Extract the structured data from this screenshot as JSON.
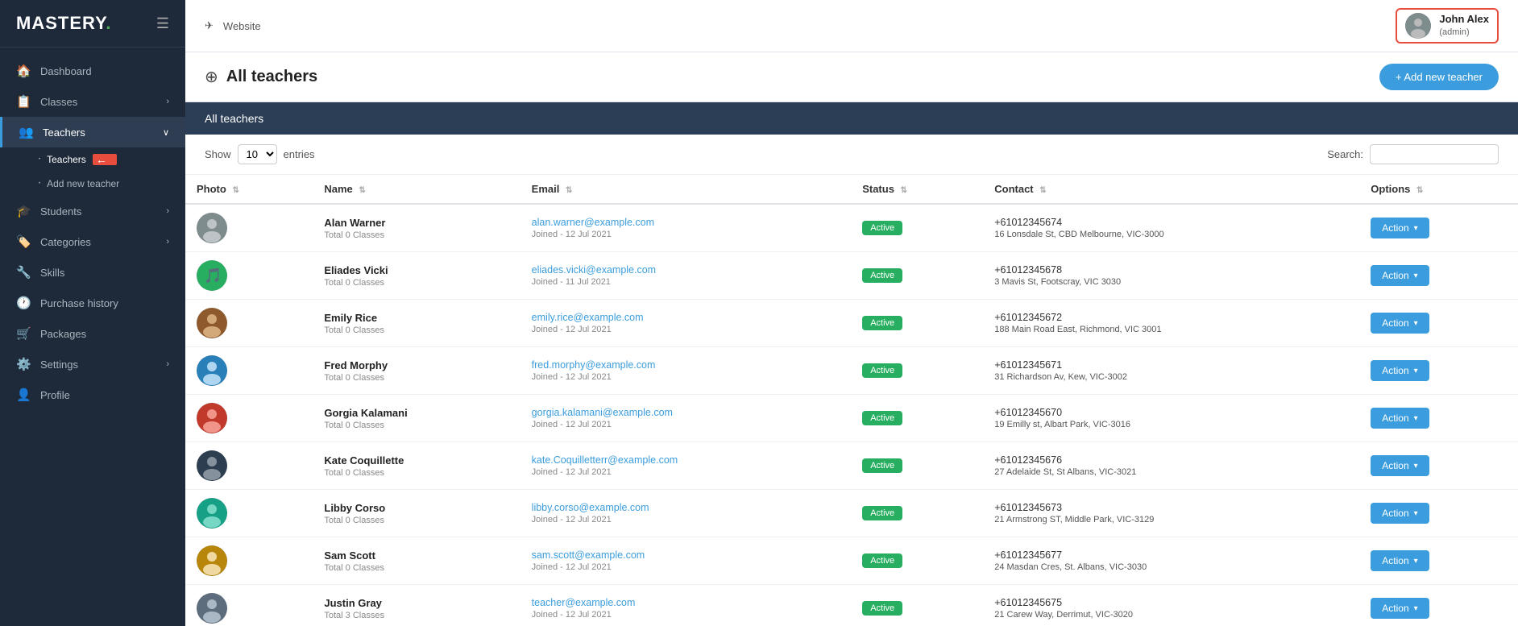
{
  "app": {
    "logo": "MASTERY.",
    "logo_dot": "."
  },
  "sidebar": {
    "items": [
      {
        "id": "dashboard",
        "label": "Dashboard",
        "icon": "🏠",
        "hasChevron": false
      },
      {
        "id": "classes",
        "label": "Classes",
        "icon": "📋",
        "hasChevron": true
      },
      {
        "id": "teachers",
        "label": "Teachers",
        "icon": "👥",
        "hasChevron": true,
        "active": true
      },
      {
        "id": "students",
        "label": "Students",
        "icon": "🎓",
        "hasChevron": true
      },
      {
        "id": "categories",
        "label": "Categories",
        "icon": "🏷️",
        "hasChevron": true
      },
      {
        "id": "skills",
        "label": "Skills",
        "icon": "🔧",
        "hasChevron": false
      },
      {
        "id": "purchase_history",
        "label": "Purchase history",
        "icon": "🕐",
        "hasChevron": false
      },
      {
        "id": "packages",
        "label": "Packages",
        "icon": "🛒",
        "hasChevron": false
      },
      {
        "id": "settings",
        "label": "Settings",
        "icon": "⚙️",
        "hasChevron": true
      },
      {
        "id": "profile",
        "label": "Profile",
        "icon": "👤",
        "hasChevron": false
      }
    ],
    "sub_items_teachers": [
      {
        "id": "teachers_sub",
        "label": "Teachers",
        "active": true
      },
      {
        "id": "add_new_teacher",
        "label": "Add new teacher",
        "active": false
      }
    ]
  },
  "topbar": {
    "website_label": "Website"
  },
  "user": {
    "name": "John Alex",
    "role": "(admin)"
  },
  "page": {
    "title": "All teachers",
    "add_button_label": "+ Add new teacher"
  },
  "table": {
    "section_title": "All teachers",
    "show_label": "Show",
    "entries_label": "entries",
    "entries_value": "10",
    "search_label": "Search:",
    "columns": [
      "Photo",
      "Name",
      "Email",
      "Status",
      "Contact",
      "Options"
    ],
    "action_label": "Action ▾",
    "teachers": [
      {
        "id": 1,
        "avatar_color": "avatar-gray",
        "avatar_char": "👤",
        "name": "Alan Warner",
        "classes": "Total 0 Classes",
        "email": "alan.warner@example.com",
        "joined": "Joined - 12 Jul 2021",
        "status": "Active",
        "phone": "+61012345674",
        "address": "16 Lonsdale St, CBD Melbourne, VIC-3000"
      },
      {
        "id": 2,
        "avatar_color": "avatar-green",
        "avatar_char": "🎵",
        "name": "Eliades Vicki",
        "classes": "Total 0 Classes",
        "email": "eliades.vicki@example.com",
        "joined": "Joined - 11 Jul 2021",
        "status": "Active",
        "phone": "+61012345678",
        "address": "3 Mavis St, Footscray, VIC 3030"
      },
      {
        "id": 3,
        "avatar_color": "avatar-brown",
        "avatar_char": "👤",
        "name": "Emily Rice",
        "classes": "Total 0 Classes",
        "email": "emily.rice@example.com",
        "joined": "Joined - 12 Jul 2021",
        "status": "Active",
        "phone": "+61012345672",
        "address": "188 Main Road East, Richmond, VIC 3001"
      },
      {
        "id": 4,
        "avatar_color": "avatar-blue",
        "avatar_char": "👤",
        "name": "Fred Morphy",
        "classes": "Total 0 Classes",
        "email": "fred.morphy@example.com",
        "joined": "Joined - 12 Jul 2021",
        "status": "Active",
        "phone": "+61012345671",
        "address": "31 Richardson Av, Kew, VIC-3002"
      },
      {
        "id": 5,
        "avatar_color": "avatar-red",
        "avatar_char": "👤",
        "name": "Gorgia Kalamani",
        "classes": "Total 0 Classes",
        "email": "gorgia.kalamani@example.com",
        "joined": "Joined - 12 Jul 2021",
        "status": "Active",
        "phone": "+61012345670",
        "address": "19 Emilly st, Albart Park, VIC-3016"
      },
      {
        "id": 6,
        "avatar_color": "avatar-dark",
        "avatar_char": "👤",
        "name": "Kate Coquillette",
        "classes": "Total 0 Classes",
        "email": "kate.Coquilletterr@example.com",
        "joined": "Joined - 12 Jul 2021",
        "status": "Active",
        "phone": "+61012345676",
        "address": "27 Adelaide St, St Albans, VIC-3021"
      },
      {
        "id": 7,
        "avatar_color": "avatar-teal",
        "avatar_char": "👤",
        "name": "Libby Corso",
        "classes": "Total 0 Classes",
        "email": "libby.corso@example.com",
        "joined": "Joined - 12 Jul 2021",
        "status": "Active",
        "phone": "+61012345673",
        "address": "21 Armstrong ST, Middle Park, VIC-3129"
      },
      {
        "id": 8,
        "avatar_color": "avatar-gold",
        "avatar_char": "👤",
        "name": "Sam Scott",
        "classes": "Total 0 Classes",
        "email": "sam.scott@example.com",
        "joined": "Joined - 12 Jul 2021",
        "status": "Active",
        "phone": "+61012345677",
        "address": "24 Masdan Cres, St. Albans, VIC-3030"
      },
      {
        "id": 9,
        "avatar_color": "avatar-slate",
        "avatar_char": "👤",
        "name": "Justin Gray",
        "classes": "Total 3 Classes",
        "email": "teacher@example.com",
        "joined": "Joined - 12 Jul 2021",
        "status": "Active",
        "phone": "+61012345675",
        "address": "21 Carew Way, Derrimut, VIC-3020"
      }
    ]
  }
}
